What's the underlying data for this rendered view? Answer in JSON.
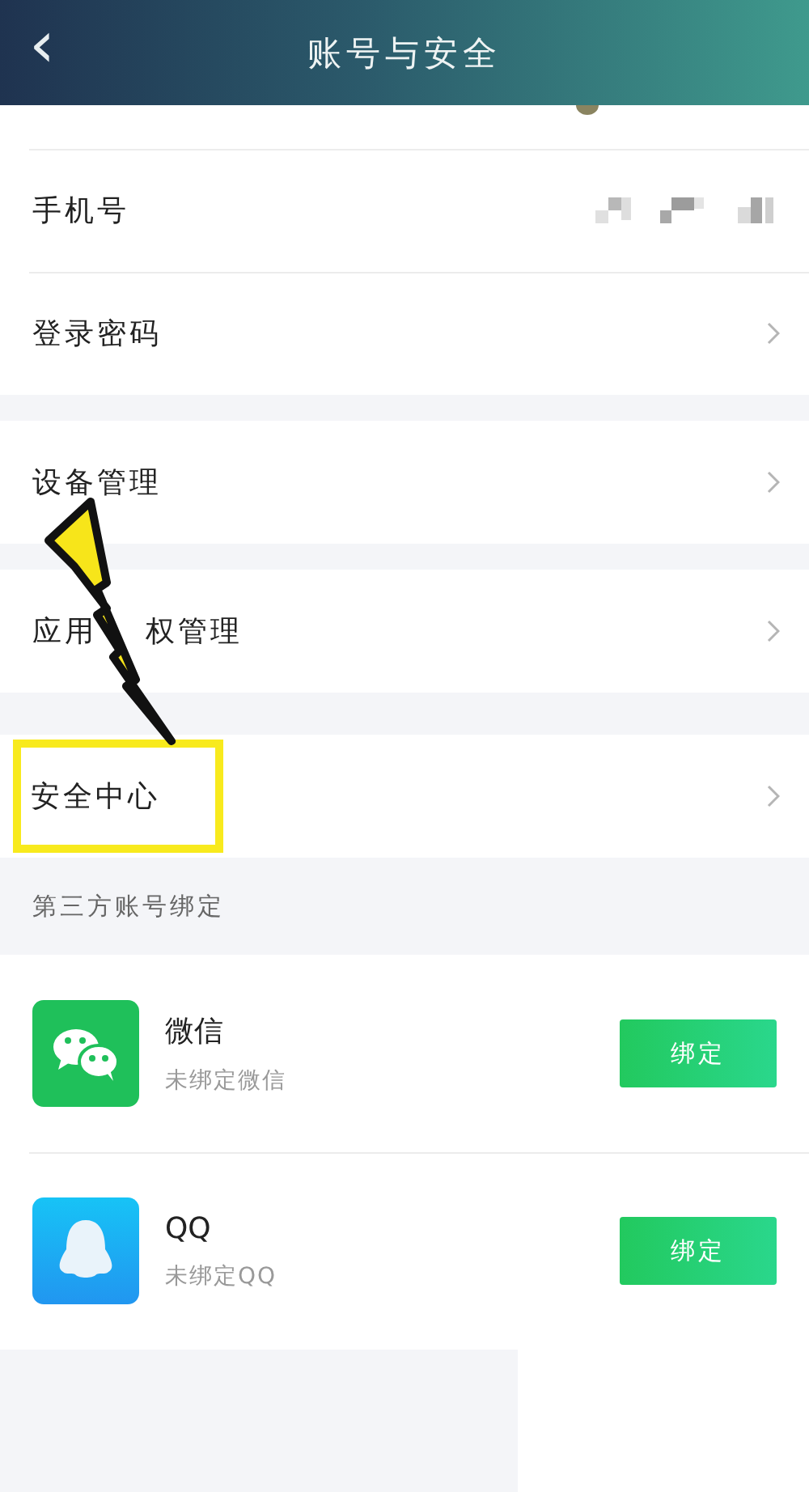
{
  "header": {
    "back": "‹",
    "title": "账号与安全"
  },
  "groups": [
    {
      "rows": [
        {
          "label": "手机号",
          "kind": "masked"
        },
        {
          "label": "登录密码",
          "kind": "link"
        }
      ]
    },
    {
      "rows": [
        {
          "label": "设备管理",
          "kind": "link"
        }
      ]
    },
    {
      "rows": [
        {
          "label_parts": [
            "应用",
            "权管理"
          ],
          "kind": "link"
        }
      ]
    },
    {
      "rows": [
        {
          "label": "安全中心",
          "kind": "link",
          "highlighted": true
        }
      ]
    }
  ],
  "section_title": "第三方账号绑定",
  "bindings": [
    {
      "kind": "wechat",
      "name": "微信",
      "status": "未绑定微信",
      "button": "绑定"
    },
    {
      "kind": "qq",
      "name": "QQ",
      "status": "未绑定QQ",
      "button": "绑定"
    }
  ]
}
